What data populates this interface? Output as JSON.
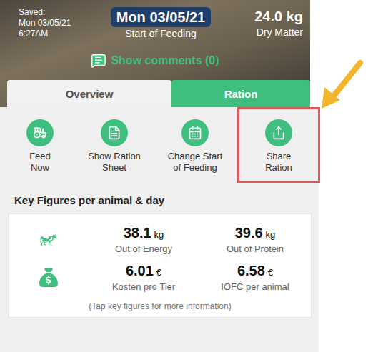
{
  "header": {
    "saved_label": "Saved:",
    "saved_date": "Mon 03/05/21",
    "saved_time": "6:27AM",
    "date": "Mon 03/05/21",
    "date_caption": "Start of Feeding",
    "dry_matter": "24.0 kg",
    "dry_matter_caption": "Dry Matter"
  },
  "comments": {
    "label": "Show comments (0)"
  },
  "tabs": [
    {
      "label": "Overview",
      "selected": true
    },
    {
      "label": "Ration",
      "selected": false
    }
  ],
  "actions": [
    {
      "label_lines": [
        "Feed",
        "Now"
      ],
      "icon": "feed",
      "highlighted": false
    },
    {
      "label_lines": [
        "Show Ration",
        "Sheet"
      ],
      "icon": "sheet",
      "highlighted": false
    },
    {
      "label_lines": [
        "Change Start",
        "of Feeding"
      ],
      "icon": "calendar",
      "highlighted": false
    },
    {
      "label_lines": [
        "Share",
        "Ration"
      ],
      "icon": "share",
      "highlighted": true
    }
  ],
  "key_figures": {
    "title": "Key Figures per animal & day",
    "rows": [
      {
        "icon": "milk",
        "items": [
          {
            "value": "38.1",
            "unit": "kg",
            "caption": "Out of Energy"
          },
          {
            "value": "39.6",
            "unit": "kg",
            "caption": "Out of Protein"
          }
        ]
      },
      {
        "icon": "money",
        "items": [
          {
            "value": "6.01",
            "unit": "€",
            "caption": "Kosten pro Tier"
          },
          {
            "value": "6.58",
            "unit": "€",
            "caption": "IOFC per animal"
          }
        ]
      }
    ],
    "hint": "(Tap key figures for more information)"
  }
}
